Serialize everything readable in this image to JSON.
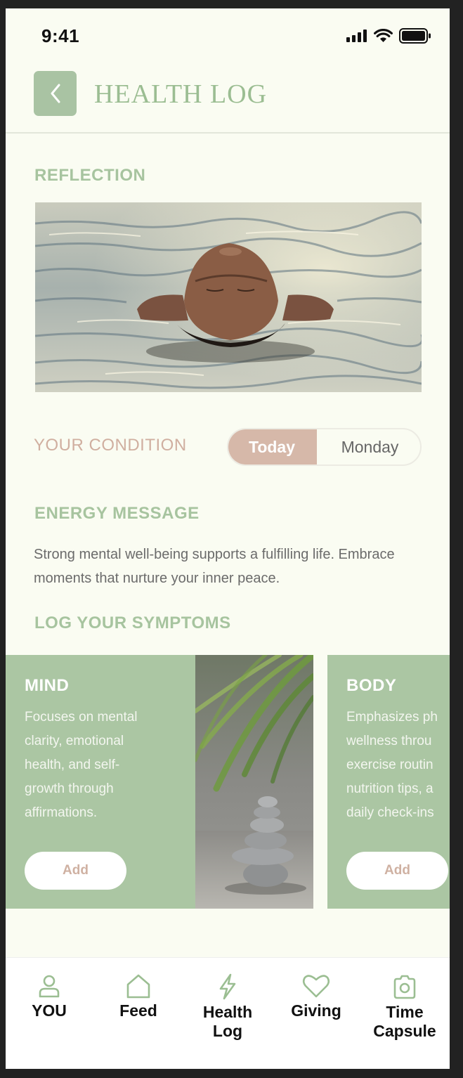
{
  "status_bar": {
    "time": "9:41"
  },
  "header": {
    "title": "HEALTH LOG"
  },
  "reflection": {
    "label": "REFLECTION"
  },
  "condition": {
    "label": "YOUR CONDITION",
    "options": [
      "Today",
      "Monday"
    ],
    "selected": "Today"
  },
  "energy": {
    "label": "ENERGY MESSAGE",
    "message": "Strong mental well-being supports a fulfilling life. Embrace moments that nurture your inner peace."
  },
  "symptoms": {
    "label": "LOG YOUR SYMPTOMS",
    "cards": [
      {
        "title": "MIND",
        "lines": [
          "Focuses on mental",
          "clarity, emotional",
          "health, and self-",
          "growth through",
          "affirmations."
        ],
        "button": "Add"
      },
      {
        "title": "BODY",
        "lines": [
          "Emphasizes ph",
          "wellness throu",
          "exercise routin",
          "nutrition tips, a",
          "daily check-ins"
        ],
        "button": "Add"
      }
    ]
  },
  "tab_bar": {
    "tabs": [
      {
        "label": "YOU",
        "icon": "user-icon"
      },
      {
        "label": "Feed",
        "icon": "home-icon"
      },
      {
        "label": "Health Log",
        "icon": "lightning-icon"
      },
      {
        "label": "Giving",
        "icon": "heart-icon"
      },
      {
        "label": "Time Capsule",
        "icon": "camera-icon"
      }
    ]
  },
  "colors": {
    "sage": "#a9c3a3",
    "sage_text": "#a7c49f",
    "blush": "#d6b8a9",
    "background": "#fafcf2"
  }
}
